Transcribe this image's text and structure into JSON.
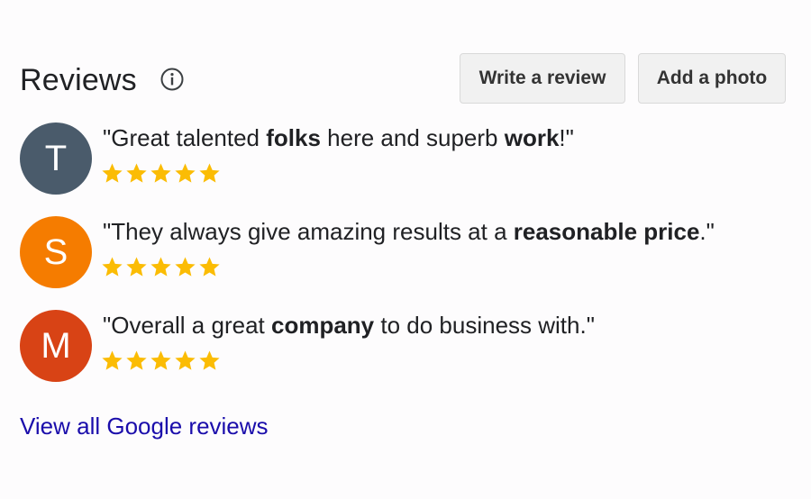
{
  "header": {
    "title": "Reviews",
    "info_icon": "info-circle-icon",
    "write_review_label": "Write a review",
    "add_photo_label": "Add a photo"
  },
  "reviews": [
    {
      "initial": "T",
      "avatar_color": "#4a5b6b",
      "rating": 5,
      "segments": [
        {
          "text": "\"Great talented ",
          "bold": false
        },
        {
          "text": "folks",
          "bold": true
        },
        {
          "text": " here and superb ",
          "bold": false
        },
        {
          "text": "work",
          "bold": true
        },
        {
          "text": "!\"",
          "bold": false
        }
      ]
    },
    {
      "initial": "S",
      "avatar_color": "#f57c00",
      "rating": 5,
      "segments": [
        {
          "text": "\"They always give amazing results at a ",
          "bold": false
        },
        {
          "text": "reasonable price",
          "bold": true
        },
        {
          "text": ".\"",
          "bold": false
        }
      ]
    },
    {
      "initial": "M",
      "avatar_color": "#d84315",
      "rating": 5,
      "segments": [
        {
          "text": "\"Overall a great ",
          "bold": false
        },
        {
          "text": "company",
          "bold": true
        },
        {
          "text": " to do business with.\"",
          "bold": false
        }
      ]
    }
  ],
  "star_color": "#fbbc04",
  "star_icon": "star-icon",
  "footer": {
    "view_all_label": "View all Google reviews",
    "link_color": "#1a0dab"
  }
}
